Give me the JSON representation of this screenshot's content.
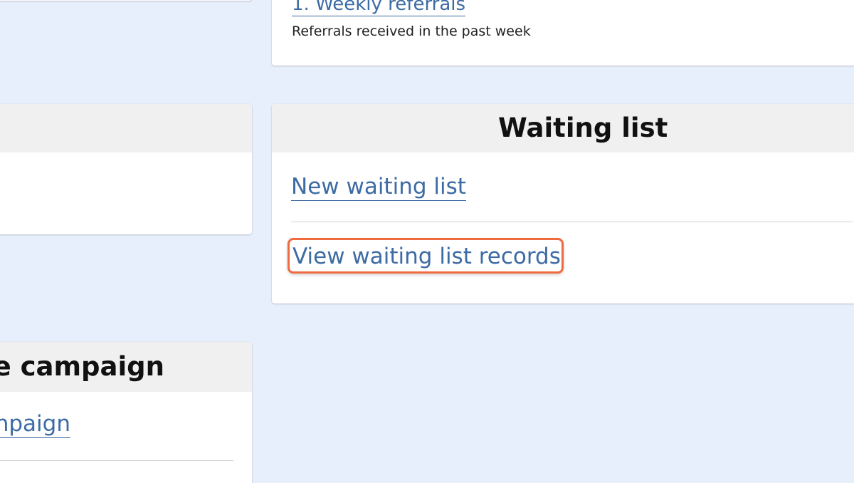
{
  "referrals_card": {
    "link_text": "1. Weekly referrals",
    "description": "Referrals received in the past week"
  },
  "waiting_list_card": {
    "title": "Waiting list",
    "links": [
      {
        "label": "New waiting list"
      },
      {
        "label": "View waiting list records"
      }
    ]
  },
  "campaign_card": {
    "title_visible": "ne campaign",
    "link_visible": "npaign"
  },
  "colors": {
    "page_background": "#e8effc",
    "link": "#3d6ba3",
    "highlight": "#ef6a3e",
    "card_header": "#f0f0f0"
  }
}
